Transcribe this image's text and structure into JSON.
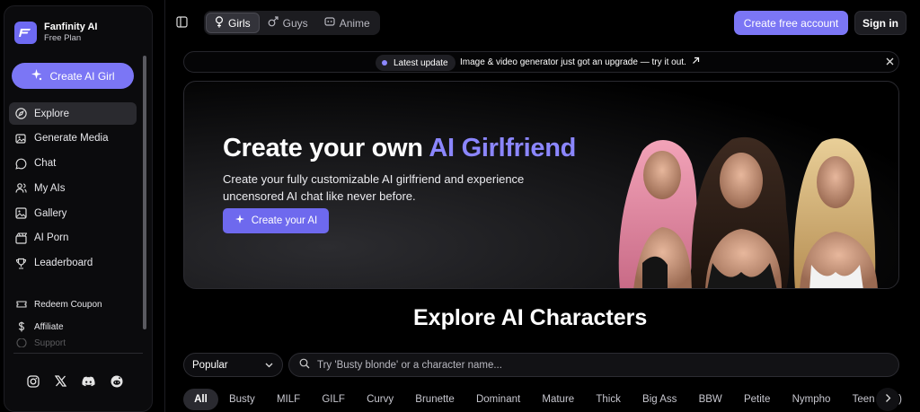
{
  "brand": {
    "name": "Fanfinity AI",
    "plan": "Free Plan",
    "logo_icon": "logo-icon"
  },
  "sidebar": {
    "create_label": "Create AI Girl",
    "items": [
      {
        "label": "Explore",
        "icon": "compass-icon"
      },
      {
        "label": "Generate Media",
        "icon": "image-edit-icon"
      },
      {
        "label": "Chat",
        "icon": "chat-bubble-icon"
      },
      {
        "label": "My AIs",
        "icon": "users-icon"
      },
      {
        "label": "Gallery",
        "icon": "gallery-icon"
      },
      {
        "label": "AI Porn",
        "icon": "film-icon"
      },
      {
        "label": "Leaderboard",
        "icon": "trophy-icon"
      }
    ],
    "secondary": [
      {
        "label": "Redeem Coupon",
        "icon": "ticket-icon"
      },
      {
        "label": "Affiliate",
        "icon": "dollar-icon"
      },
      {
        "label": "Support",
        "icon": "help-icon"
      }
    ],
    "socials": [
      "instagram-icon",
      "x-icon",
      "discord-icon",
      "reddit-icon"
    ]
  },
  "topbar": {
    "tabs": [
      {
        "label": "Girls",
        "icon": "female-icon"
      },
      {
        "label": "Guys",
        "icon": "male-icon"
      },
      {
        "label": "Anime",
        "icon": "anime-icon"
      }
    ],
    "create_account": "Create free account",
    "sign_in": "Sign in"
  },
  "banner": {
    "badge": "Latest update",
    "text": "Image & video generator just got an upgrade — try it out."
  },
  "hero": {
    "title_main": "Create your own ",
    "title_accent": "AI Girlfriend",
    "subtitle": "Create your fully customizable AI girlfriend and experience uncensored AI chat like never before.",
    "button": "Create your AI"
  },
  "explore": {
    "title": "Explore AI Characters",
    "sort_value": "Popular",
    "search_placeholder": "Try 'Busty blonde' or a character name...",
    "tags": [
      "All",
      "Busty",
      "MILF",
      "GILF",
      "Curvy",
      "Brunette",
      "Dominant",
      "Mature",
      "Thick",
      "Big Ass",
      "BBW",
      "Petite",
      "Nympho",
      "Teen (18+)"
    ]
  },
  "colors": {
    "accent": "#7b76f5",
    "accent_text": "#8b86ff",
    "background": "#000000",
    "sidebar": "#0b0b0d"
  }
}
